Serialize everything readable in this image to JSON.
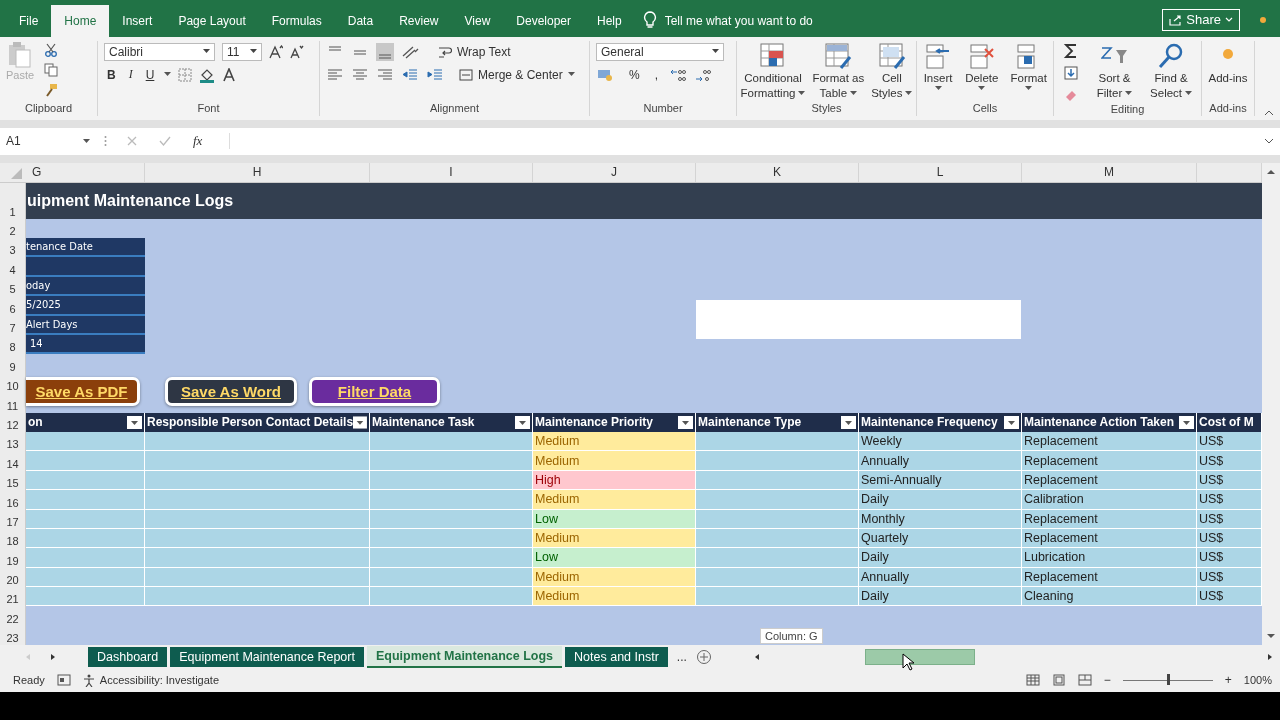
{
  "menu_tabs": [
    {
      "label": "File",
      "selected": false
    },
    {
      "label": "Home",
      "selected": true
    },
    {
      "label": "Insert",
      "selected": false
    },
    {
      "label": "Page Layout",
      "selected": false
    },
    {
      "label": "Formulas",
      "selected": false
    },
    {
      "label": "Data",
      "selected": false
    },
    {
      "label": "Review",
      "selected": false
    },
    {
      "label": "View",
      "selected": false
    },
    {
      "label": "Developer",
      "selected": false
    },
    {
      "label": "Help",
      "selected": false
    }
  ],
  "tell_me": "Tell me what you want to do",
  "share": "Share",
  "ribbon": {
    "clipboard": {
      "label": "Clipboard",
      "paste": "Paste",
      "paste_disabled": true
    },
    "font": {
      "label": "Font",
      "family": "Calibri",
      "size": "11",
      "styles": [
        "B",
        "I",
        "U"
      ]
    },
    "alignment": {
      "label": "Alignment",
      "wrap": "Wrap Text",
      "merge": "Merge & Center"
    },
    "number": {
      "label": "Number",
      "format": "General",
      "symbols": [
        "%",
        ","
      ]
    },
    "styles": {
      "label": "Styles",
      "buttons": [
        {
          "line1": "Conditional",
          "line2": "Formatting"
        },
        {
          "line1": "Format as",
          "line2": "Table"
        },
        {
          "line1": "Cell",
          "line2": "Styles"
        }
      ]
    },
    "cells": {
      "label": "Cells",
      "buttons": [
        "Insert",
        "Delete",
        "Format"
      ]
    },
    "editing": {
      "label": "Editing",
      "buttons": [
        {
          "line1": "Sort &",
          "line2": "Filter"
        },
        {
          "line1": "Find &",
          "line2": "Select"
        }
      ]
    },
    "addins": {
      "label": "Add-ins",
      "button": "Add-ins"
    }
  },
  "formula_bar": {
    "name_box": "A1",
    "fx": "fx"
  },
  "sheet": {
    "columns": [
      "G",
      "H",
      "I",
      "J",
      "K",
      "L",
      "M"
    ],
    "row_numbers": [
      "1",
      "2",
      "3",
      "4",
      "5",
      "6",
      "7",
      "8",
      "9",
      "10",
      "11",
      "12",
      "13",
      "14",
      "15",
      "16",
      "17",
      "18",
      "19",
      "20",
      "21",
      "22",
      "23"
    ],
    "title": "uipment Maintenance Logs",
    "panel": {
      "title": "tenance Date",
      "today_label": "oday",
      "today": "5/2025",
      "alert_label": "Alert Days",
      "alert_days": "14"
    },
    "buttons": [
      {
        "label": "Save As PDF",
        "color": "#8b3f0b"
      },
      {
        "label": "Save As Word",
        "color": "#2e3644"
      },
      {
        "label": "Filter Data",
        "color": "#6a2c9e"
      }
    ]
  },
  "table": {
    "headers": [
      {
        "label": "on",
        "filter": true
      },
      {
        "label": "Responsible Person Contact Details",
        "filter": true
      },
      {
        "label": "Maintenance Task",
        "filter": true
      },
      {
        "label": "Maintenance Priority",
        "filter": true
      },
      {
        "label": "Maintenance Type",
        "filter": true
      },
      {
        "label": "Maintenance Frequency",
        "filter": true
      },
      {
        "label": "Maintenance Action Taken",
        "filter": true
      },
      {
        "label": "Cost of M",
        "filter": false
      }
    ],
    "rows": [
      {
        "priority": {
          "text": "Medium",
          "color": "#ffeb9c"
        },
        "frequency": "Weekly",
        "action": "Replacement",
        "cost": "US$"
      },
      {
        "priority": {
          "text": "Medium",
          "color": "#ffeb9c"
        },
        "frequency": "Annually",
        "action": "Replacement",
        "cost": "US$"
      },
      {
        "priority": {
          "text": "High",
          "color": "#ffc7ce"
        },
        "frequency": "Semi-Annually",
        "action": "Replacement",
        "cost": "US$"
      },
      {
        "priority": {
          "text": "Medium",
          "color": "#ffeb9c"
        },
        "frequency": "Daily",
        "action": "Calibration",
        "cost": "US$"
      },
      {
        "priority": {
          "text": "Low",
          "color": "#c6efce"
        },
        "frequency": "Monthly",
        "action": "Replacement",
        "cost": "US$"
      },
      {
        "priority": {
          "text": "Medium",
          "color": "#ffeb9c"
        },
        "frequency": "Quartely",
        "action": "Replacement",
        "cost": "US$"
      },
      {
        "priority": {
          "text": "Low",
          "color": "#c6efce"
        },
        "frequency": "Daily",
        "action": "Lubrication",
        "cost": "US$"
      },
      {
        "priority": {
          "text": "Medium",
          "color": "#ffeb9c"
        },
        "frequency": "Annually",
        "action": "Replacement",
        "cost": "US$"
      },
      {
        "priority": {
          "text": "Medium",
          "color": "#ffeb9c"
        },
        "frequency": "Daily",
        "action": "Cleaning",
        "cost": "US$"
      }
    ]
  },
  "tooltip": "Column: G",
  "sheet_tabs": [
    {
      "label": "Dashboard",
      "selected": false
    },
    {
      "label": "Equipment Maintenance Report",
      "selected": false
    },
    {
      "label": "Equipment Maintenance Logs",
      "selected": true
    },
    {
      "label": "Notes and Instr",
      "selected": false
    }
  ],
  "more_tabs": "...",
  "status": {
    "ready": "Ready",
    "accessibility": "Accessibility: Investigate",
    "zoom_out": "−",
    "zoom_in": "+",
    "zoom": "100%",
    "zoom_slider": {
      "level": 0.5
    }
  }
}
